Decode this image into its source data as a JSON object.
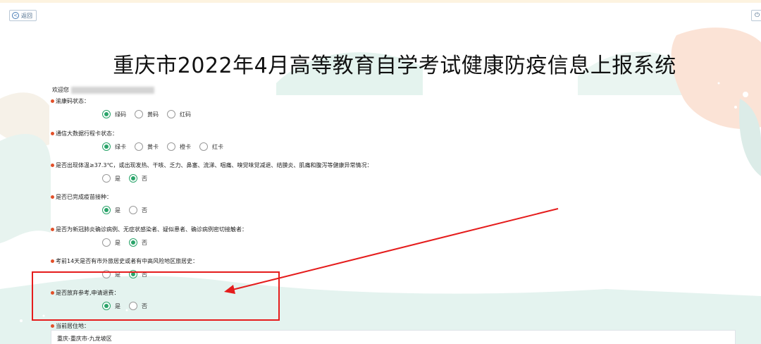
{
  "header": {
    "back_label": "返回",
    "title": "重庆市2022年4月高等教育自学考试健康防疫信息上报系统"
  },
  "welcome": {
    "prefix": "欢迎您"
  },
  "questions": [
    {
      "label": "渝康码状态：",
      "options": [
        {
          "label": "绿码",
          "selected": true
        },
        {
          "label": "黄码",
          "selected": false
        },
        {
          "label": "红码",
          "selected": false
        }
      ]
    },
    {
      "label": "通信大数据行程卡状态：",
      "options": [
        {
          "label": "绿卡",
          "selected": true
        },
        {
          "label": "黄卡",
          "selected": false
        },
        {
          "label": "橙卡",
          "selected": false
        },
        {
          "label": "红卡",
          "selected": false
        }
      ]
    },
    {
      "label": "是否出现体温≥37.3℃，或出现发热、干咳、乏力、鼻塞、流涕、咽痛、嗅觉味觉减退、结膜炎、肌痛和腹泻等健康异常情况：",
      "options": [
        {
          "label": "是",
          "selected": false
        },
        {
          "label": "否",
          "selected": true
        }
      ]
    },
    {
      "label": "是否已完成疫苗接种：",
      "options": [
        {
          "label": "是",
          "selected": true
        },
        {
          "label": "否",
          "selected": false
        }
      ]
    },
    {
      "label": "是否为新冠肺炎确诊病例、无症状感染者、疑似患者、确诊病例密切接触者：",
      "options": [
        {
          "label": "是",
          "selected": false
        },
        {
          "label": "否",
          "selected": true
        }
      ]
    },
    {
      "label": "考前14天是否有市外旅居史或者有中高风险地区旅居史：",
      "options": [
        {
          "label": "是",
          "selected": false
        },
        {
          "label": "否",
          "selected": true
        }
      ]
    },
    {
      "label": "是否放弃参考,申请退费：",
      "options": [
        {
          "label": "是",
          "selected": true
        },
        {
          "label": "否",
          "selected": false
        }
      ]
    }
  ],
  "address": {
    "label": "当前居住地：",
    "value": "重庆-重庆市-九龙坡区"
  },
  "colors": {
    "accent_green": "#2aa46a",
    "required_dot": "#e2502a",
    "annotation_red": "#e51c1c"
  }
}
